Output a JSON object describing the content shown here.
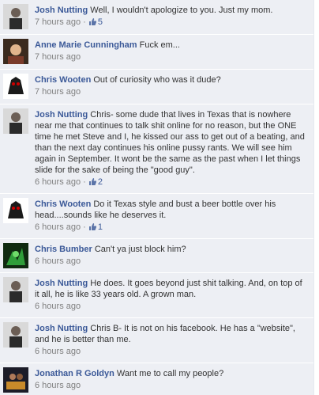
{
  "comments": [
    {
      "author": "Josh Nutting",
      "text": "Well, I wouldn't apologize to you. Just my mom.",
      "time": "7 hours ago",
      "likes": "5",
      "avatar": "josh-avatar"
    },
    {
      "author": "Anne Marie Cunningham",
      "text": "Fuck em...",
      "time": "7 hours ago",
      "likes": "",
      "avatar": "anne-avatar"
    },
    {
      "author": "Chris Wooten",
      "text": "Out of curiosity who was it dude?",
      "time": "7 hours ago",
      "likes": "",
      "avatar": "chris-wooten-avatar"
    },
    {
      "author": "Josh Nutting",
      "text": "Chris- some dude that lives in Texas that is nowhere near me that continues to talk shit online for no reason, but the ONE time he met Steve and I, he kissed our ass to get out of a beating, and than the next day continues his online pussy rants. We will see him again in September. It wont be the same as the past when I let things slide for the sake of being the \"good guy\".",
      "time": "6 hours ago",
      "likes": "2",
      "avatar": "josh-avatar"
    },
    {
      "author": "Chris Wooten",
      "text": "Do it Texas style and bust a beer bottle over his head....sounds like he deserves it.",
      "time": "6 hours ago",
      "likes": "1",
      "avatar": "chris-wooten-avatar"
    },
    {
      "author": "Chris Bumber",
      "text": "Can't ya just block him?",
      "time": "6 hours ago",
      "likes": "",
      "avatar": "chris-bumber-avatar"
    },
    {
      "author": "Josh Nutting",
      "text": "He does. It goes beyond just shit talking. And, on top of it all, he is like 33 years old. A grown man.",
      "time": "6 hours ago",
      "likes": "",
      "avatar": "josh-avatar"
    },
    {
      "author": "Josh Nutting",
      "text": "Chris B- It is not on his facebook. He has a \"website\", and he is better than me.",
      "time": "6 hours ago",
      "likes": "",
      "avatar": "josh-avatar"
    },
    {
      "author": "Jonathan R Goldyn",
      "text": "Want me to call my people?",
      "time": "6 hours ago",
      "likes": "",
      "avatar": "jonathan-avatar"
    }
  ],
  "colors": {
    "link": "#3b5998",
    "background": "#edeff4",
    "meta": "#808080"
  }
}
